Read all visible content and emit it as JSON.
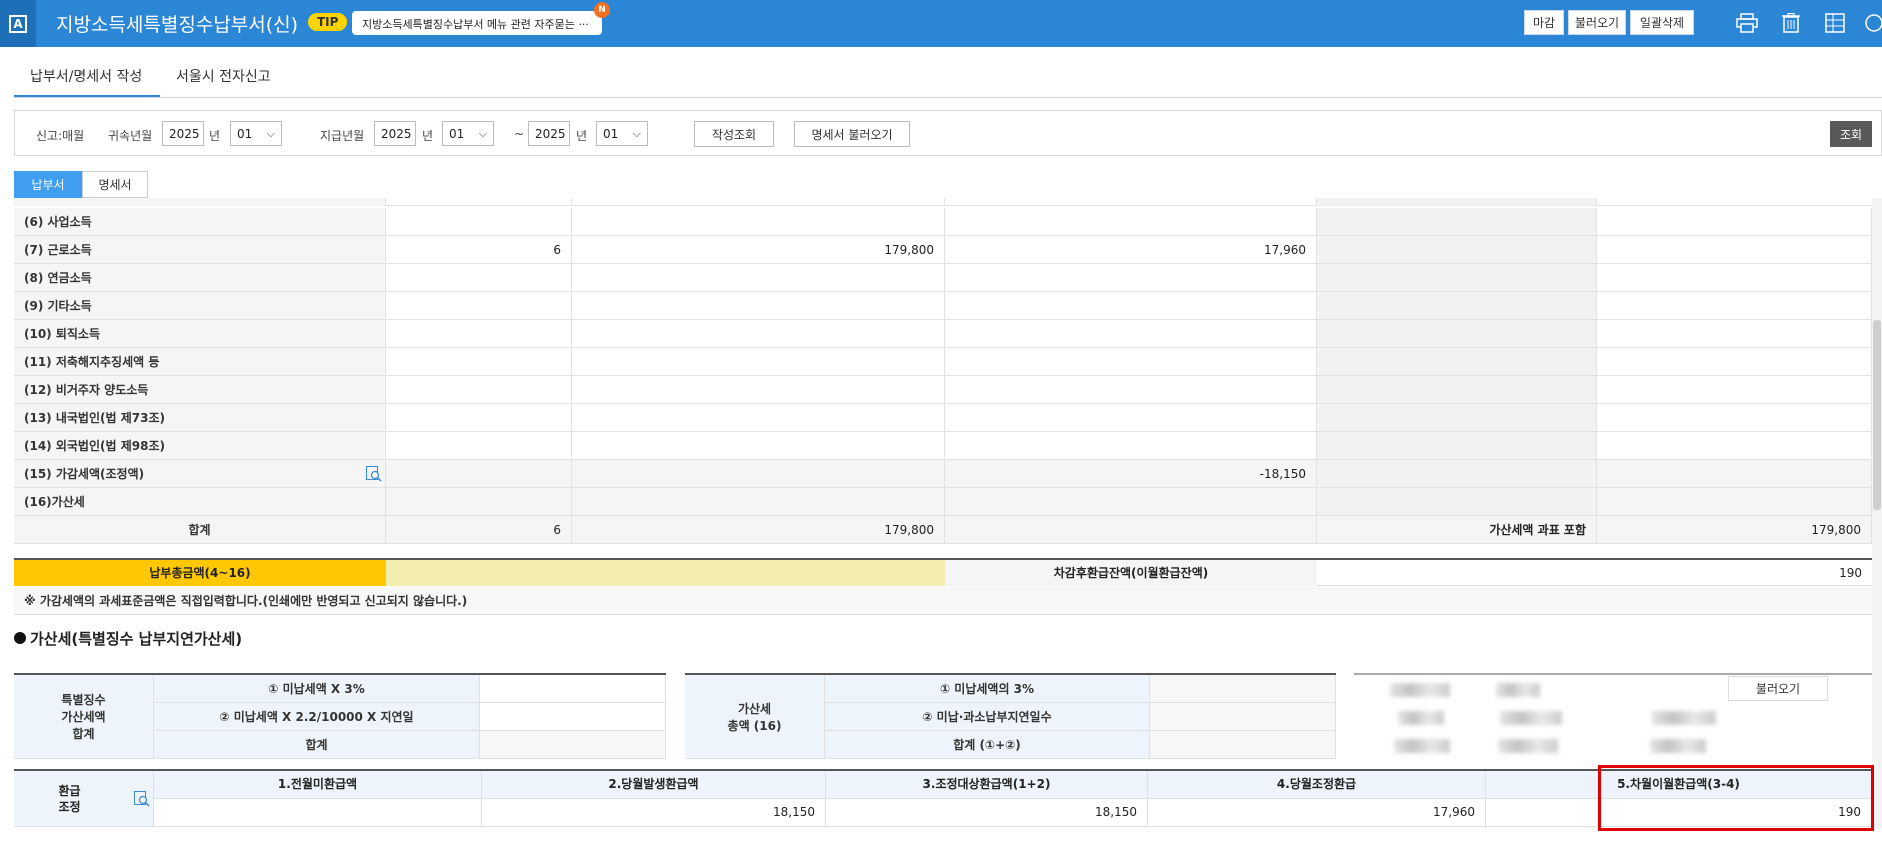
{
  "header": {
    "logo": "A",
    "title": "지방소득세특별징수납부서(신)",
    "tip_badge": "TIP",
    "tip_text": "지방소득세특별징수납부서 메뉴 관련 자주묻는 ···",
    "tip_new": "N",
    "buttons": [
      "마감",
      "불러오기",
      "일괄삭제"
    ]
  },
  "tabs": [
    "납부서/명세서 작성",
    "서울시 전자신고"
  ],
  "filter": {
    "report_label": "신고:매월",
    "belong_label": "귀속년월",
    "belong_year": "2025",
    "year_unit": "년",
    "belong_month": "01",
    "pay_label": "지급년월",
    "pay_year_from": "2025",
    "pay_month_from": "01",
    "tilde": "~",
    "pay_year_to": "2025",
    "pay_month_to": "01",
    "btn_lookup_written": "작성조회",
    "btn_load_statement": "명세서 불러오기",
    "btn_search": "조회"
  },
  "subtabs": [
    "납부서",
    "명세서"
  ],
  "grid_rows": [
    {
      "label": "(6) 사업소득",
      "c1": "",
      "c2": "",
      "c3": "",
      "c4": "",
      "c5": ""
    },
    {
      "label": "(7) 근로소득",
      "c1": "6",
      "c2": "179,800",
      "c3": "17,960",
      "c4": "",
      "c5": ""
    },
    {
      "label": "(8) 연금소득",
      "c1": "",
      "c2": "",
      "c3": "",
      "c4": "",
      "c5": ""
    },
    {
      "label": "(9) 기타소득",
      "c1": "",
      "c2": "",
      "c3": "",
      "c4": "",
      "c5": ""
    },
    {
      "label": "(10) 퇴직소득",
      "c1": "",
      "c2": "",
      "c3": "",
      "c4": "",
      "c5": ""
    },
    {
      "label": "(11) 저축해지추징세액 등",
      "c1": "",
      "c2": "",
      "c3": "",
      "c4": "",
      "c5": ""
    },
    {
      "label": "(12) 비거주자 양도소득",
      "c1": "",
      "c2": "",
      "c3": "",
      "c4": "",
      "c5": ""
    },
    {
      "label": "(13) 내국법인(법 제73조)",
      "c1": "",
      "c2": "",
      "c3": "",
      "c4": "",
      "c5": ""
    },
    {
      "label": "(14) 외국법인(법 제98조)",
      "c1": "",
      "c2": "",
      "c3": "",
      "c4": "",
      "c5": ""
    },
    {
      "label": "(15) 가감세액(조정액)",
      "c1": "",
      "c2": "",
      "c3": "-18,150",
      "c4": "",
      "c5": ""
    },
    {
      "label": "(16)가산세",
      "c1": "",
      "c2": "",
      "c3": "",
      "c4": "",
      "c5": ""
    },
    {
      "label": "합계",
      "c1": "6",
      "c2": "179,800",
      "c3": "",
      "c4": "가산세액 과표 포함",
      "c5": "179,800"
    }
  ],
  "payment": {
    "total_label": "납부총금액(4~16)",
    "after_refund_label": "차감후환급잔액(이월환급잔액)",
    "after_refund_value": "190",
    "note": "※ 가감세액의 과세표준금액은 직접입력합니다.(인쇄에만 반영되고 신고되지 않습니다.)"
  },
  "add_tax": {
    "title": "가산세(특별징수 납부지연가산세)",
    "left_head": "특별징수\n가산세액\n합계",
    "left_rows": [
      "① 미납세액 X 3%",
      "② 미납세액 X 2.2/10000 X 지연일",
      "합계"
    ],
    "mid_head": "가산세\n총액 (16)",
    "mid_rows": [
      "① 미납세액의 3%",
      "② 미납·과소납부지연일수",
      "합계 (①+②)"
    ],
    "load_btn": "불러오기"
  },
  "refund": {
    "head": "환급\n조정",
    "cols": [
      "1.전월미환급액",
      "2.당월발생환급액",
      "3.조정대상환급액(1+2)",
      "4.당월조정환급",
      "5.차월이월환급액(3-4)"
    ],
    "vals": [
      "",
      "18,150",
      "18,150",
      "17,960",
      "190"
    ]
  },
  "colors": {
    "header_blue": "#2b86d6",
    "total_yellow": "#ffc800",
    "highlight_red": "#e00000"
  }
}
